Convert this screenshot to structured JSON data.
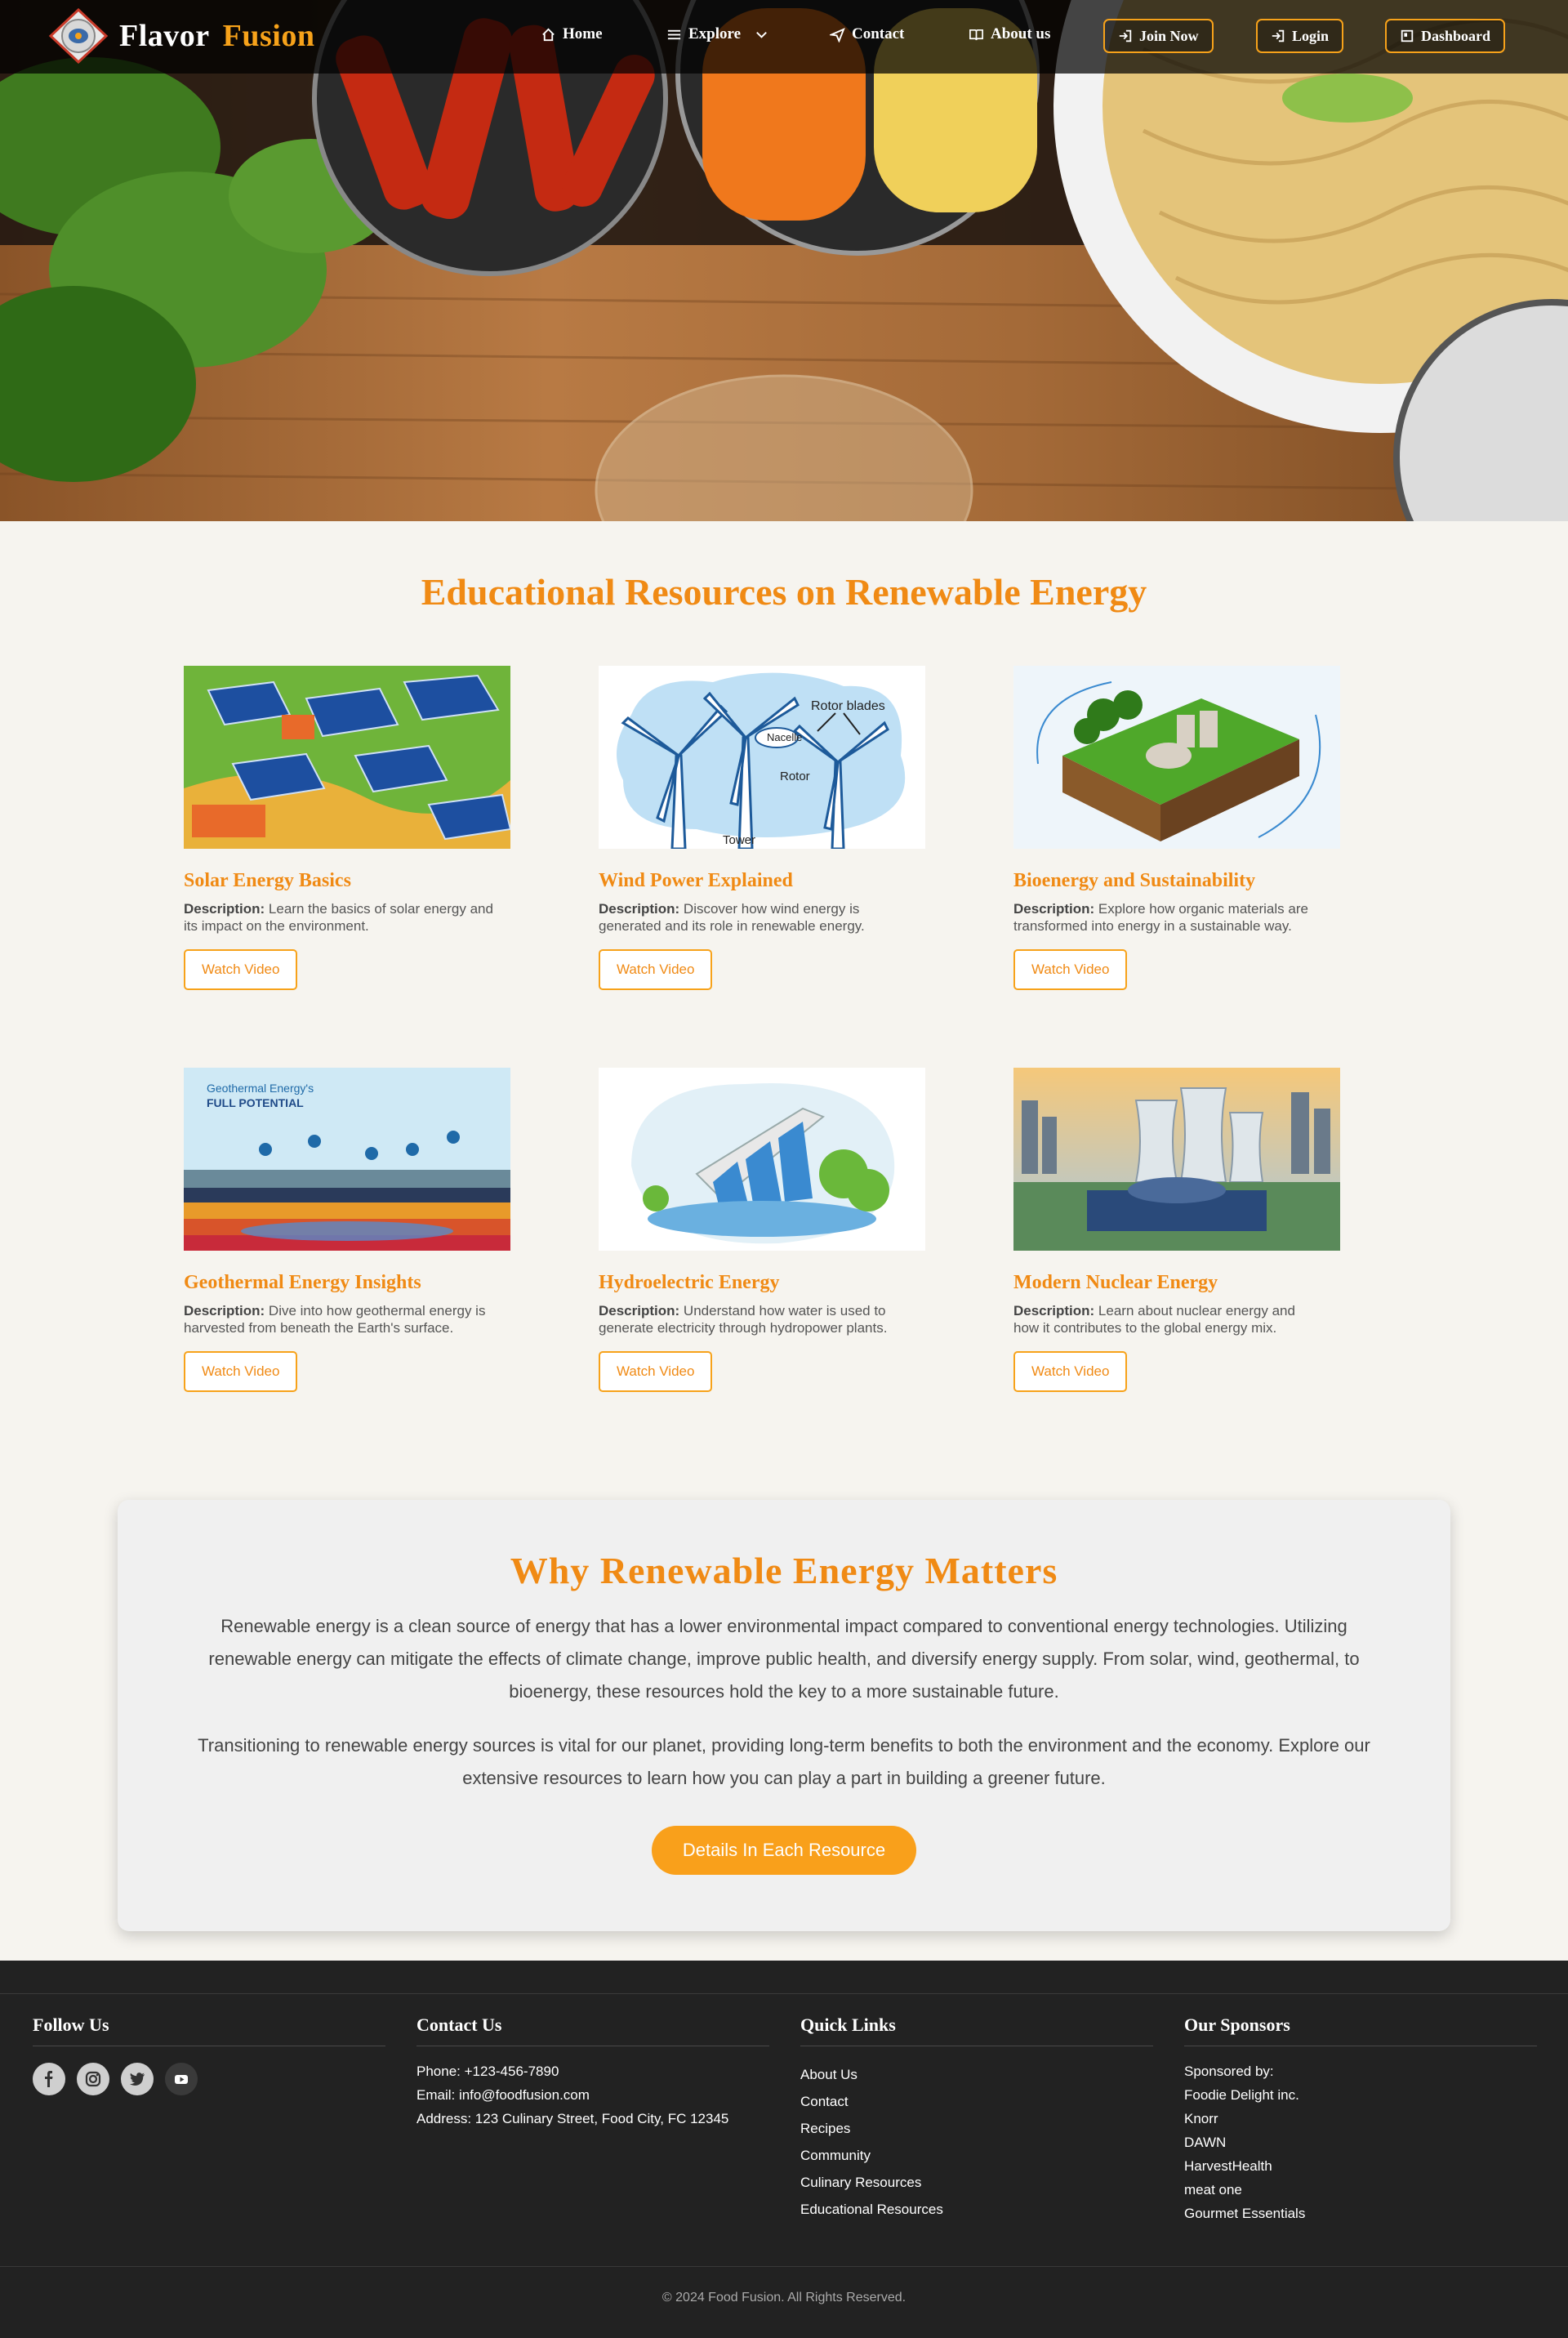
{
  "brand": {
    "name_1": "Flavor",
    "name_2": "Fusion"
  },
  "nav": {
    "home": "Home",
    "explore": "Explore",
    "contact": "Contact",
    "about": "About us",
    "join": "Join Now",
    "login": "Login",
    "dashboard": "Dashboard"
  },
  "resources": {
    "title": "Educational Resources on Renewable Energy",
    "watch_label": "Watch Video",
    "desc_label": "Description:",
    "cards": [
      {
        "title": "Solar Energy Basics",
        "desc": "Learn the basics of solar energy and its impact on the environment."
      },
      {
        "title": "Wind Power Explained",
        "desc": "Discover how wind energy is generated and its role in renewable energy."
      },
      {
        "title": "Bioenergy and Sustainability",
        "desc": "Explore how organic materials are transformed into energy in a sustainable way."
      },
      {
        "title": "Geothermal Energy Insights",
        "desc": "Dive into how geothermal energy is harvested from beneath the Earth's surface."
      },
      {
        "title": "Hydroelectric Energy",
        "desc": "Understand how water is used to generate electricity through hydropower plants."
      },
      {
        "title": "Modern Nuclear Energy",
        "desc": "Learn about nuclear energy and how it contributes to the global energy mix."
      }
    ],
    "wind_labels": {
      "blades": "Rotor blades",
      "nacelle": "Nacelle",
      "rotor": "Rotor",
      "tower": "Tower"
    },
    "geo_labels": {
      "line1": "Geothermal Energy's",
      "line2": "FULL POTENTIAL"
    }
  },
  "why": {
    "title": "Why Renewable Energy Matters",
    "p1": "Renewable energy is a clean source of energy that has a lower environmental impact compared to conventional energy technologies. Utilizing renewable energy can mitigate the effects of climate change, improve public health, and diversify energy supply. From solar, wind, geothermal, to bioenergy, these resources hold the key to a more sustainable future.",
    "p2": "Transitioning to renewable energy sources is vital for our planet, providing long-term benefits to both the environment and the economy. Explore our extensive resources to learn how you can play a part in building a greener future.",
    "button": "Details In Each Resource"
  },
  "footer": {
    "follow": {
      "title": "Follow Us"
    },
    "contact": {
      "title": "Contact Us",
      "phone": "Phone: +123-456-7890",
      "email": "Email: info@foodfusion.com",
      "address": "Address: 123 Culinary Street, Food City, FC 12345"
    },
    "links": {
      "title": "Quick Links",
      "items": [
        "About Us",
        "Contact",
        "Recipes",
        "Community",
        "Culinary Resources",
        "Educational Resources"
      ]
    },
    "sponsors": {
      "title": "Our Sponsors",
      "intro": "Sponsored by:",
      "items": [
        "Foodie Delight inc.",
        "Knorr",
        "DAWN",
        "HarvestHealth",
        "meat one",
        "Gourmet Essentials"
      ]
    },
    "copyright": "© 2024 Food Fusion. All Rights Reserved."
  },
  "colors": {
    "accent": "#f08a14",
    "button": "#f9a01b",
    "footer_bg": "#222222",
    "page_bg": "#f6f4ef"
  }
}
